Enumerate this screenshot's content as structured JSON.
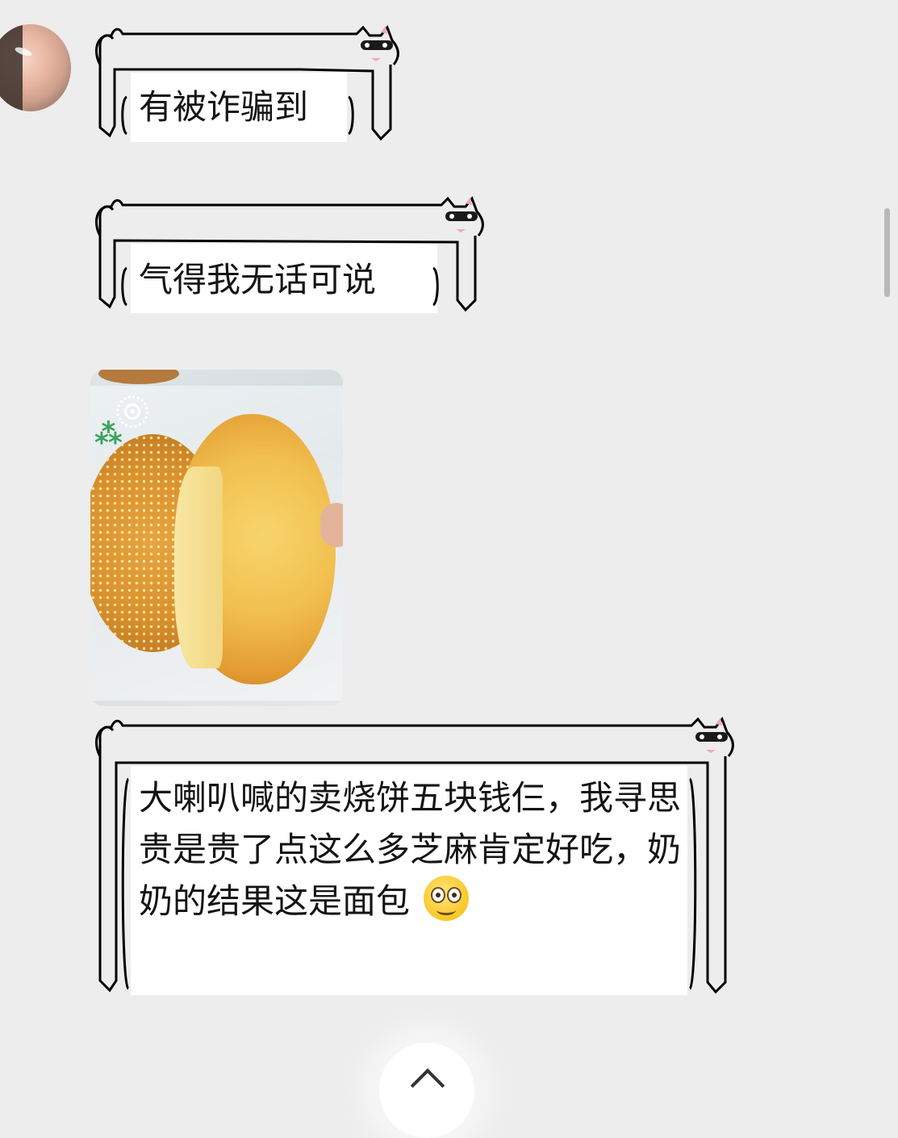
{
  "chat": {
    "messages": [
      {
        "type": "text",
        "text": "有被诈骗到"
      },
      {
        "type": "text",
        "text": "气得我无话可说"
      },
      {
        "type": "image",
        "icon": "live-photo-icon"
      },
      {
        "type": "text",
        "text": "大喇叭喊的卖烧饼五块钱仨，我寻思贵是贵了点这么多芝麻肯定好吃，奶奶的结果这是面包",
        "emoji": "smiling-face-emoji"
      }
    ]
  },
  "controls": {
    "scroll_down_icon": "chevron-down-icon"
  },
  "colors": {
    "background": "#ededed",
    "bubble": "#ffffff",
    "text": "#141414",
    "cat_ear": "#f4a7b9"
  }
}
